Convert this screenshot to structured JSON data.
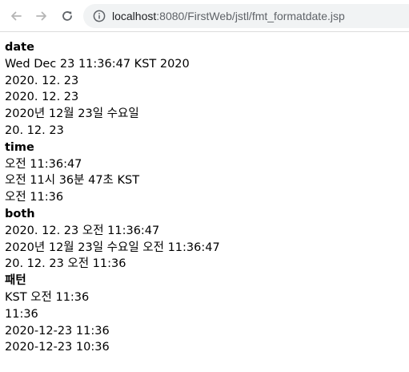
{
  "browser": {
    "url_host": "localhost",
    "url_rest": ":8080/FirstWeb/jstl/fmt_formatdate.jsp"
  },
  "icons": {
    "back": "arrow-left-icon",
    "forward": "arrow-right-icon",
    "reload": "reload-icon",
    "info": "info-icon"
  },
  "sections": [
    {
      "heading": "date",
      "lines": [
        "Wed Dec 23 11:36:47 KST 2020",
        "2020. 12. 23",
        "2020. 12. 23",
        "2020년 12월 23일 수요일",
        "20. 12. 23"
      ]
    },
    {
      "heading": "time",
      "lines": [
        "오전 11:36:47",
        "오전 11시 36분 47초 KST",
        "오전 11:36"
      ]
    },
    {
      "heading": "both",
      "lines": [
        "2020. 12. 23 오전 11:36:47",
        "2020년 12월 23일 수요일 오전 11:36:47",
        "20. 12. 23 오전 11:36"
      ]
    },
    {
      "heading": "패턴",
      "lines": [
        "KST 오전 11:36",
        "11:36",
        "2020-12-23 11:36",
        "2020-12-23 10:36"
      ]
    }
  ]
}
